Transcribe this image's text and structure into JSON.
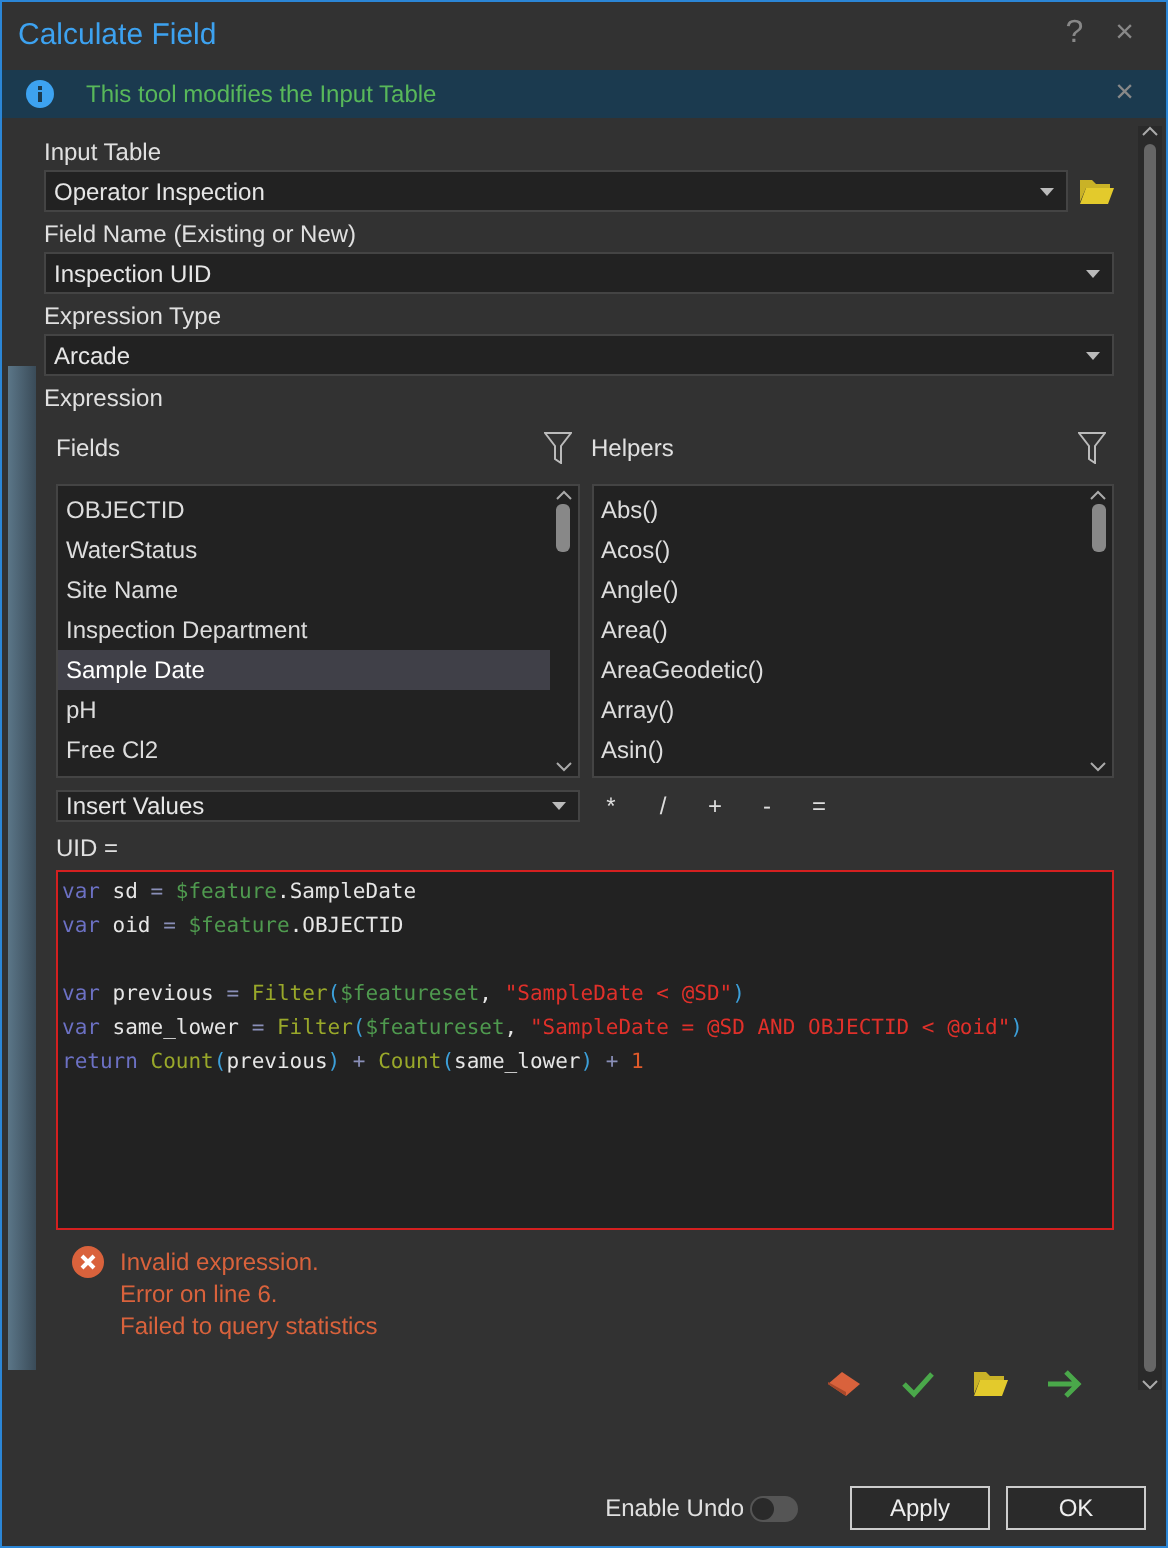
{
  "window": {
    "title": "Calculate Field",
    "help": "?",
    "close": "×"
  },
  "info_bar": {
    "message": "This tool modifies the Input Table",
    "close": "×"
  },
  "params": [
    {
      "label": "Input Table",
      "value": "Operator Inspection",
      "browse": true
    },
    {
      "label": "Field Name (Existing or New)",
      "value": "Inspection UID",
      "browse": false
    },
    {
      "label": "Expression Type",
      "value": "Arcade",
      "browse": false
    }
  ],
  "expression": {
    "label": "Expression",
    "fields": {
      "title": "Fields",
      "items": [
        {
          "label": "OBJECTID",
          "selected": false
        },
        {
          "label": "WaterStatus",
          "selected": false
        },
        {
          "label": "Site Name",
          "selected": false
        },
        {
          "label": "Inspection Department",
          "selected": false
        },
        {
          "label": "Sample Date",
          "selected": true
        },
        {
          "label": "pH",
          "selected": false
        },
        {
          "label": "Free Cl2",
          "selected": false
        }
      ]
    },
    "helpers": {
      "title": "Helpers",
      "items": [
        {
          "label": "Abs()",
          "selected": false
        },
        {
          "label": "Acos()",
          "selected": false
        },
        {
          "label": "Angle()",
          "selected": false
        },
        {
          "label": "Area()",
          "selected": false
        },
        {
          "label": "AreaGeodetic()",
          "selected": false
        },
        {
          "label": "Array()",
          "selected": false
        },
        {
          "label": "Asin()",
          "selected": false
        }
      ]
    },
    "insert_values": "Insert Values",
    "operators": [
      "*",
      "/",
      "+",
      "-",
      "="
    ],
    "target": "UID =",
    "code_lines": [
      {
        "kind": "code",
        "tokens": [
          {
            "kind": "keyword",
            "text": "var"
          },
          {
            "kind": "ident",
            "text": " sd "
          },
          {
            "kind": "op",
            "text": "="
          },
          {
            "kind": "global",
            "text": " $feature"
          },
          {
            "kind": "ident",
            "text": ".SampleDate"
          }
        ]
      },
      {
        "kind": "code",
        "tokens": [
          {
            "kind": "keyword",
            "text": "var"
          },
          {
            "kind": "ident",
            "text": " oid "
          },
          {
            "kind": "op",
            "text": "="
          },
          {
            "kind": "global",
            "text": " $feature"
          },
          {
            "kind": "ident",
            "text": ".OBJECTID"
          }
        ]
      },
      {
        "kind": "blank"
      },
      {
        "kind": "code",
        "tokens": [
          {
            "kind": "keyword",
            "text": "var"
          },
          {
            "kind": "ident",
            "text": " previous "
          },
          {
            "kind": "op",
            "text": "="
          },
          {
            "kind": "func",
            "text": " Filter"
          },
          {
            "kind": "paren",
            "text": "("
          },
          {
            "kind": "global",
            "text": "$featureset"
          },
          {
            "kind": "ident",
            "text": ", "
          },
          {
            "kind": "string",
            "text": "\"SampleDate < @SD\""
          },
          {
            "kind": "paren",
            "text": ")"
          }
        ]
      },
      {
        "kind": "code",
        "tokens": [
          {
            "kind": "keyword",
            "text": "var"
          },
          {
            "kind": "ident",
            "text": " same_lower "
          },
          {
            "kind": "op",
            "text": "="
          },
          {
            "kind": "func",
            "text": " Filter"
          },
          {
            "kind": "paren",
            "text": "("
          },
          {
            "kind": "global",
            "text": "$featureset"
          },
          {
            "kind": "ident",
            "text": ", "
          },
          {
            "kind": "string",
            "text": "\"SampleDate = @SD AND OBJECTID < @oid\""
          },
          {
            "kind": "paren",
            "text": ")"
          }
        ]
      },
      {
        "kind": "code",
        "tokens": [
          {
            "kind": "keyword",
            "text": "return"
          },
          {
            "kind": "func",
            "text": " Count"
          },
          {
            "kind": "paren",
            "text": "("
          },
          {
            "kind": "ident",
            "text": "previous"
          },
          {
            "kind": "paren",
            "text": ")"
          },
          {
            "kind": "op",
            "text": " + "
          },
          {
            "kind": "func",
            "text": "Count"
          },
          {
            "kind": "paren",
            "text": "("
          },
          {
            "kind": "ident",
            "text": "same_lower"
          },
          {
            "kind": "paren",
            "text": ")"
          },
          {
            "kind": "op",
            "text": " + "
          },
          {
            "kind": "number",
            "text": "1"
          }
        ]
      }
    ],
    "invalid": true,
    "errors": [
      "Invalid expression.",
      "Error on line 6.",
      "Failed to query statistics"
    ]
  },
  "footer": {
    "undo": {
      "label": "Enable Undo",
      "on": false
    },
    "buttons": [
      "Apply",
      "OK"
    ]
  }
}
